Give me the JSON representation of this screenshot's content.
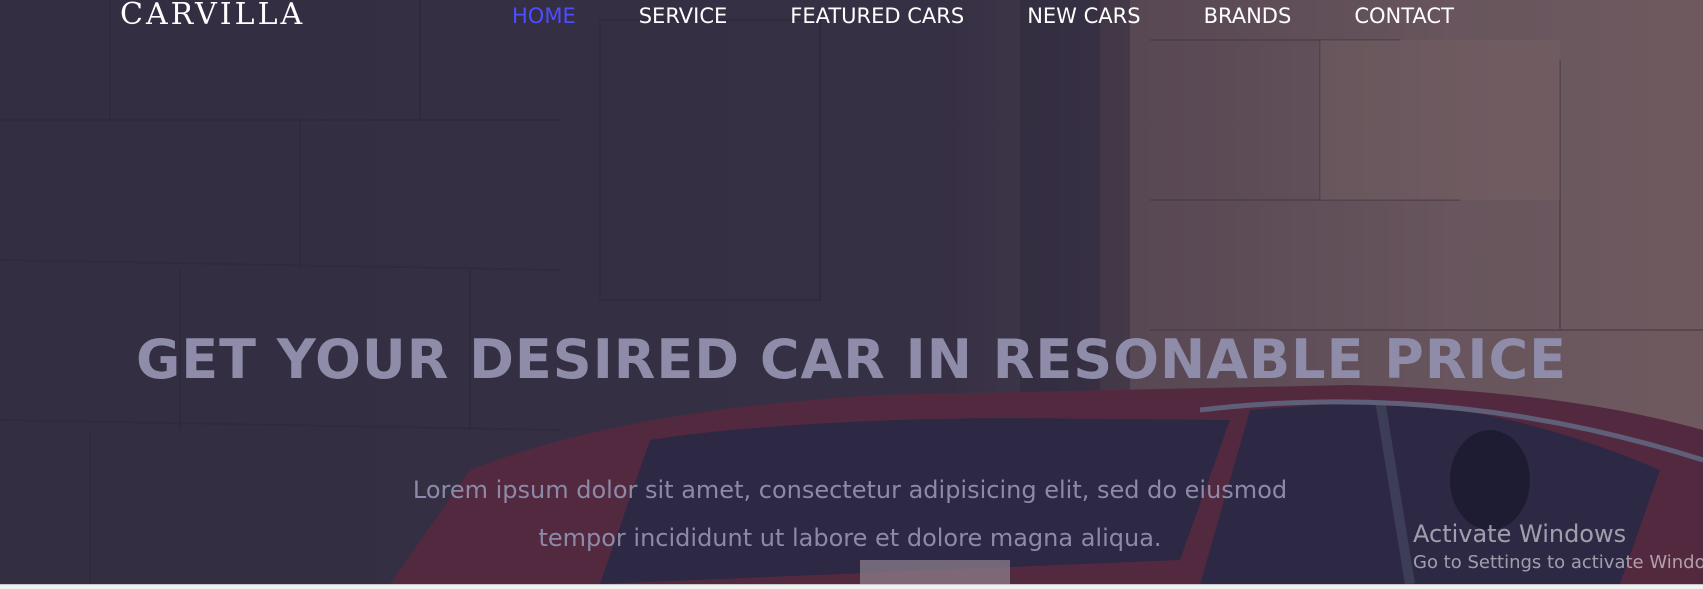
{
  "brand": {
    "logo_text": "CARVILLA"
  },
  "nav": {
    "items": [
      {
        "label": "HOME",
        "active": true
      },
      {
        "label": "SERVICE",
        "active": false
      },
      {
        "label": "FEATURED CARS",
        "active": false
      },
      {
        "label": "NEW CARS",
        "active": false
      },
      {
        "label": "BRANDS",
        "active": false
      },
      {
        "label": "CONTACT",
        "active": false
      }
    ]
  },
  "hero": {
    "title": "GET YOUR DESIRED CAR IN RESONABLE PRICE",
    "subtitle_line1": "Lorem ipsum dolor sit amet, consectetur adipisicing elit, sed do eiusmod",
    "subtitle_line2": "tempor incididunt ut labore et dolore magna aliqua."
  },
  "watermark": {
    "title": "Activate Windows",
    "subtitle": "Go to Settings to activate Windows."
  },
  "colors": {
    "nav_active": "#4d4dff",
    "nav_default": "#ffffff",
    "hero_text": "#8e8ca8"
  }
}
